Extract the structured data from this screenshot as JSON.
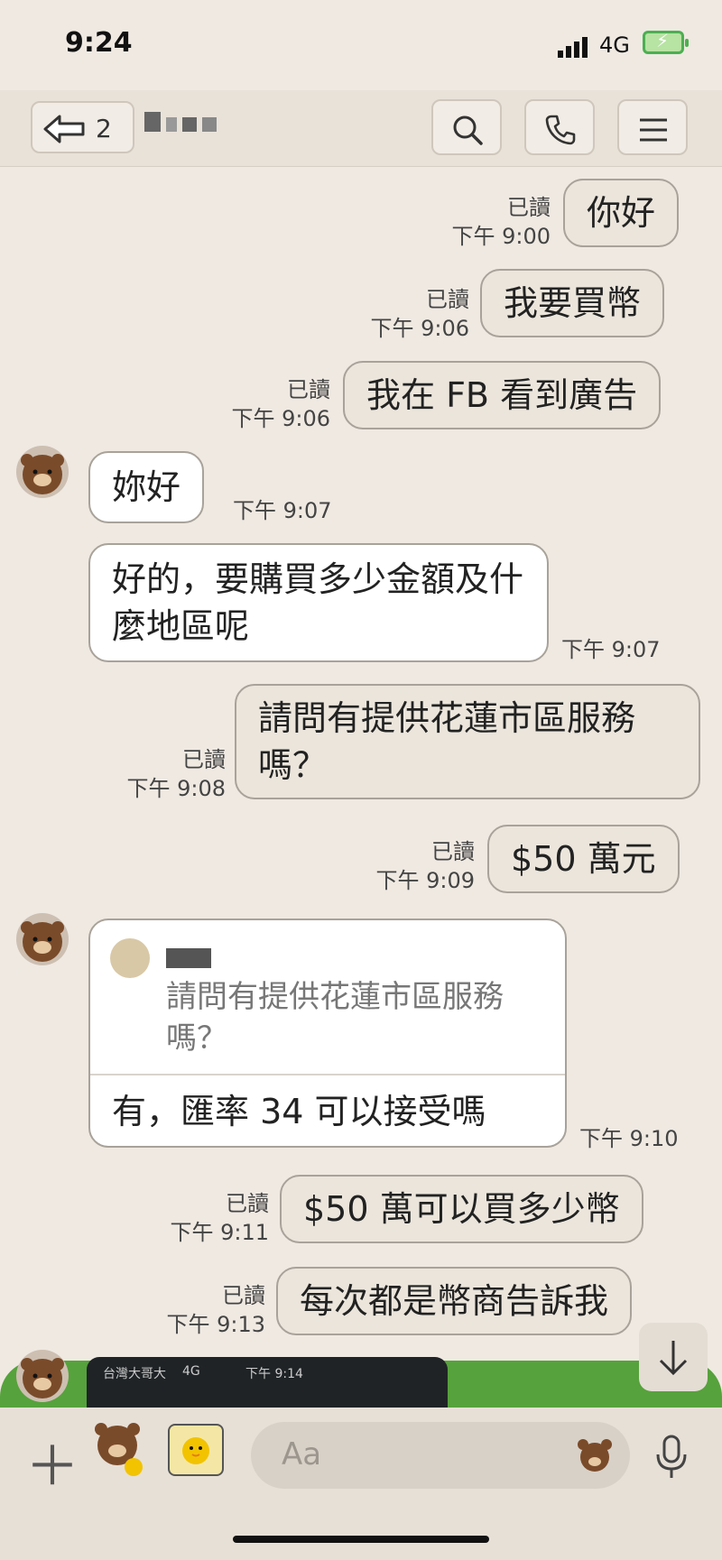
{
  "status": {
    "time": "9:24",
    "network": "4G"
  },
  "header": {
    "unread_count": "2"
  },
  "messages": [
    {
      "side": "out",
      "text": "你好",
      "read": "已讀",
      "time": "下午 9:00"
    },
    {
      "side": "out",
      "text": "我要買幣",
      "read": "已讀",
      "time": "下午 9:06"
    },
    {
      "side": "out",
      "text": "我在 FB 看到廣告",
      "read": "已讀",
      "time": "下午 9:06"
    },
    {
      "side": "in",
      "text": "妳好",
      "time": "下午 9:07"
    },
    {
      "side": "in",
      "text": "好的，要購買多少金額及什麼地區呢",
      "time": "下午 9:07"
    },
    {
      "side": "out",
      "text": "請問有提供花蓮市區服務嗎？",
      "read": "已讀",
      "time": "下午 9:08"
    },
    {
      "side": "out",
      "text": "$50 萬元",
      "read": "已讀",
      "time": "下午 9:09"
    },
    {
      "side": "in",
      "quote": "請問有提供花蓮市區服務嗎？",
      "text": "有，匯率 34 可以接受嗎",
      "time": "下午 9:10"
    },
    {
      "side": "out",
      "text": "$50 萬可以買多少幣",
      "read": "已讀",
      "time": "下午 9:11"
    },
    {
      "side": "out",
      "text": "每次都是幣商告訴我",
      "read": "已讀",
      "time": "下午 9:13"
    }
  ],
  "preview": {
    "carrier": "台灣大哥大",
    "network": "4G",
    "time": "下午 9:14"
  },
  "input": {
    "placeholder": "Aa"
  }
}
